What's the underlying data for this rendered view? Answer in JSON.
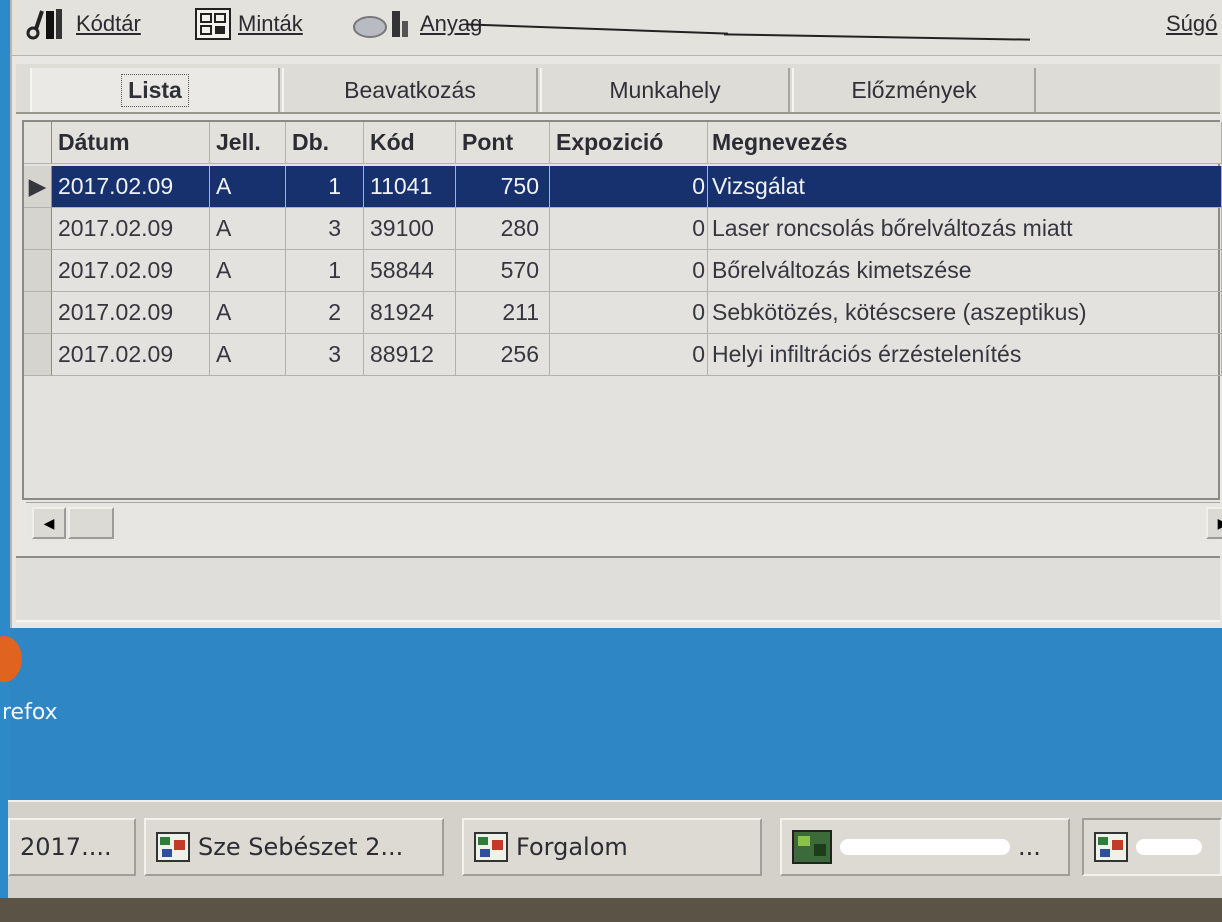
{
  "menu": {
    "items": [
      {
        "label": "Kódtár",
        "icon": "scissors-tools-icon"
      },
      {
        "label": "Minták",
        "icon": "templates-icon"
      },
      {
        "label": "Anyag",
        "icon": "material-icon"
      }
    ],
    "help": "Súgó"
  },
  "tabs": [
    {
      "label": "Lista"
    },
    {
      "label": "Beavatkozás"
    },
    {
      "label": "Munkahely"
    },
    {
      "label": "Előzmények"
    }
  ],
  "table": {
    "headers": [
      "Dátum",
      "Jell.",
      "Db.",
      "Kód",
      "Pont",
      "Expozició",
      "Megnevezés"
    ],
    "rows": [
      [
        "2017.02.09",
        "A",
        "1",
        "11041",
        "750",
        "0",
        "Vizsgálat"
      ],
      [
        "2017.02.09",
        "A",
        "3",
        "39100",
        "280",
        "0",
        "Laser roncsolás bőrelváltozás miatt"
      ],
      [
        "2017.02.09",
        "A",
        "1",
        "58844",
        "570",
        "0",
        "Bőrelváltozás kimetszése"
      ],
      [
        "2017.02.09",
        "A",
        "2",
        "81924",
        "211",
        "0",
        "Sebkötözés, kötéscsere (aszeptikus)"
      ],
      [
        "2017.02.09",
        "A",
        "3",
        "88912",
        "256",
        "0",
        "Helyi infiltrációs érzéstelenítés"
      ]
    ]
  },
  "desktop": {
    "label": "refox"
  },
  "taskbar": {
    "items": [
      {
        "label": "2017...."
      },
      {
        "label": "Sze Sebészet 2..."
      },
      {
        "label": "Forgalom"
      },
      {
        "label": "..."
      },
      {
        "label": ""
      }
    ]
  },
  "colors": {
    "selection": "#17306e",
    "desktop": "#2e86c4",
    "window": "#e9e7e3"
  }
}
